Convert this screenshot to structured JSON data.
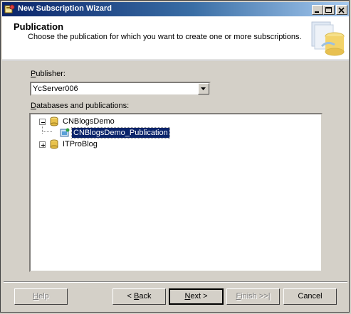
{
  "window": {
    "title": "New Subscription Wizard"
  },
  "header": {
    "title": "Publication",
    "subtitle": "Choose the publication for which you want to create one or more subscriptions."
  },
  "publisher": {
    "label_accel": "P",
    "label_rest": "ublisher:",
    "value": "YcServer006"
  },
  "databases": {
    "label_accel": "D",
    "label_rest": "atabases and publications:",
    "tree": [
      {
        "label": "CNBlogsDemo",
        "expanded": true,
        "icon": "database-icon"
      },
      {
        "label": "CNBlogsDemo_Publication",
        "selected": true,
        "icon": "publication-icon"
      },
      {
        "label": "ITProBlog",
        "expanded": false,
        "icon": "database-icon"
      }
    ]
  },
  "buttons": {
    "help": {
      "accel": "H",
      "rest": "elp"
    },
    "back": {
      "prefix": "< ",
      "accel": "B",
      "rest": "ack"
    },
    "next": {
      "accel": "N",
      "rest": "ext >"
    },
    "finish": {
      "accel": "F",
      "rest": "inish >>|"
    },
    "cancel": {
      "label": "Cancel"
    }
  },
  "colors": {
    "title_bar_start": "#0a246a",
    "title_bar_end": "#a6caf0",
    "selection": "#0a246a",
    "dialog_bg": "#d4d0c8"
  }
}
